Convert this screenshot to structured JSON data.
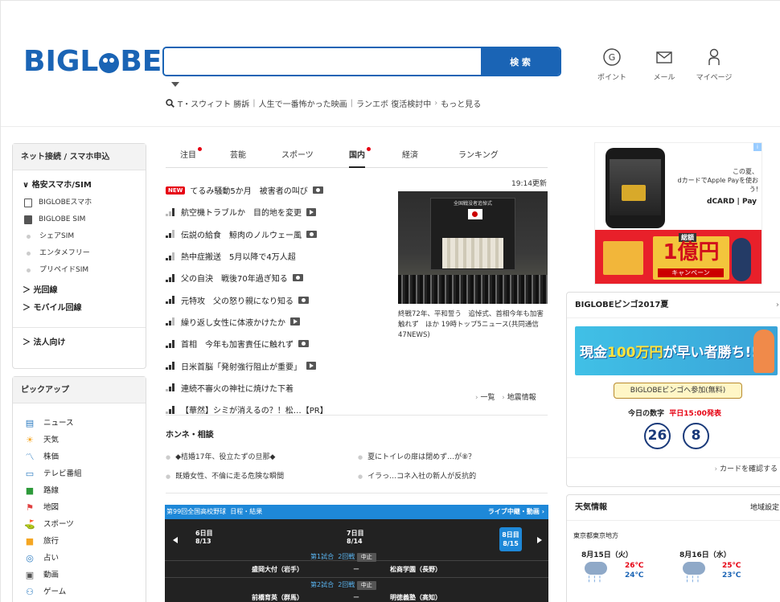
{
  "header": {
    "logo_text": "BIGLOBE",
    "search_placeholder": "",
    "search_button": "検 索",
    "trend_items": [
      "T・スウィフト 勝訴",
      "人生で一番怖かった映画",
      "ランエボ 復活検討中"
    ],
    "trend_more": "もっと見る",
    "icons": [
      {
        "label": "ポイント",
        "icon": "g-point-icon"
      },
      {
        "label": "メール",
        "icon": "mail-icon"
      },
      {
        "label": "マイページ",
        "icon": "person-icon"
      }
    ]
  },
  "left_nav": {
    "title": "ネット接続 / スマホ申込",
    "sections": {
      "sim": "格安スマホ/SIM",
      "sim_items": [
        "BIGLOBEスマホ",
        "BIGLOBE SIM",
        "シェアSIM",
        "エンタメフリー",
        "プリペイドSIM"
      ],
      "fiber": "光回線",
      "mobile": "モバイル回線",
      "corporate": "法人向け"
    },
    "pickup_title": "ピックアップ",
    "pickup": [
      {
        "label": "ニュース",
        "icon": "news-icon"
      },
      {
        "label": "天気",
        "icon": "weather-icon"
      },
      {
        "label": "株価",
        "icon": "stock-icon"
      },
      {
        "label": "テレビ番組",
        "icon": "tv-icon"
      },
      {
        "label": "路線",
        "icon": "train-icon"
      },
      {
        "label": "地図",
        "icon": "map-icon"
      },
      {
        "label": "スポーツ",
        "icon": "golf-icon"
      },
      {
        "label": "旅行",
        "icon": "suitcase-icon"
      },
      {
        "label": "占い",
        "icon": "fortune-icon"
      },
      {
        "label": "動画",
        "icon": "video-icon"
      },
      {
        "label": "ゲーム",
        "icon": "game-icon"
      }
    ]
  },
  "news": {
    "tabs": [
      "注目",
      "芸能",
      "スポーツ",
      "国内",
      "経済",
      "ランキング"
    ],
    "updated": "19:14更新",
    "items": [
      {
        "text": "てるみ騒動5か月　被害者の叫び",
        "media": "photo",
        "new": true
      },
      {
        "text": "航空機トラブルか　目的地を変更",
        "media": "video"
      },
      {
        "text": "伝説の給食　鯨肉のノルウェー風",
        "media": "photo"
      },
      {
        "text": "熱中症搬送　5月以降で4万人超",
        "media": ""
      },
      {
        "text": "父の自決　戦後70年過ぎ知る",
        "media": "photo"
      },
      {
        "text": "元特攻　父の怒り親になり知る",
        "media": "photo"
      },
      {
        "text": "繰り返し女性に体液かけたか",
        "media": "video"
      },
      {
        "text": "首相　今年も加害責任に触れず",
        "media": "photo"
      },
      {
        "text": "日米首脳「発射強行阻止が重要」",
        "media": "video"
      },
      {
        "text": "連続不審火の神社に焼けた下着",
        "media": ""
      },
      {
        "text": "【華然】シミが消えるの？！松…【PR】",
        "media": ""
      }
    ],
    "new_badge": "NEW",
    "photo_caption": "終戦72年、平和誓う　追悼式、首相今年も加害触れず　ほか 19時トップ5ニュース(共同通信 47NEWS)",
    "photo_banner": "全国戦没者追悼式",
    "more_list": "一覧",
    "more_quake": "地震情報"
  },
  "honne": {
    "title": "ホンネ・相談",
    "items": [
      "◆桔婚17年、役立たずの旦那◆",
      "夏にトイレの扉は閉めず…が⑧？",
      "既婚女性、不倫に走る危険な瞬間",
      "イラっ…コネ入社の新人が反抗的"
    ]
  },
  "baseball": {
    "title": "第99回全国高校野球",
    "schedule": "日程・結果",
    "live": "ライブ中継・動画",
    "days": [
      {
        "day": "6日目",
        "date": "8/13"
      },
      {
        "day": "7日目",
        "date": "8/14"
      },
      {
        "day": "8日目",
        "date": "8/15"
      }
    ],
    "games": [
      {
        "label": "第1試合",
        "round": "2回戦",
        "status": "中止",
        "home": "盛岡大付（岩手）",
        "away": "松商学園（長野）"
      },
      {
        "label": "第2試合",
        "round": "2回戦",
        "status": "中止",
        "home": "前橋育英（群馬）",
        "away": "明徳義塾（高知）"
      }
    ],
    "dash": "ー"
  },
  "ad": {
    "text_line1": "この夏、",
    "text_line2": "dカードでApple Payを使おう!",
    "brand": "dCARD | Pay",
    "total_label": "総額",
    "prize": "1億円",
    "campaign": "キャンペーン"
  },
  "bingo": {
    "title": "BIGLOBEビンゴ2017夏",
    "banner_a": "現金",
    "banner_b": "100万円",
    "banner_c": "が早い者勝ち!!",
    "join_button": "BIGLOBEビンゴへ参加(無料)",
    "today_label": "今日の数字",
    "today_time": "平日15:00発表",
    "numbers": [
      "26",
      "8"
    ],
    "card_link": "カードを確認する"
  },
  "weather": {
    "title": "天気情報",
    "setting": "地域設定",
    "location": "東京都東京地方",
    "days": [
      {
        "date": "8月15日（火）",
        "hi": "26℃",
        "lo": "24℃"
      },
      {
        "date": "8月16日（水）",
        "hi": "25℃",
        "lo": "23℃"
      }
    ]
  }
}
